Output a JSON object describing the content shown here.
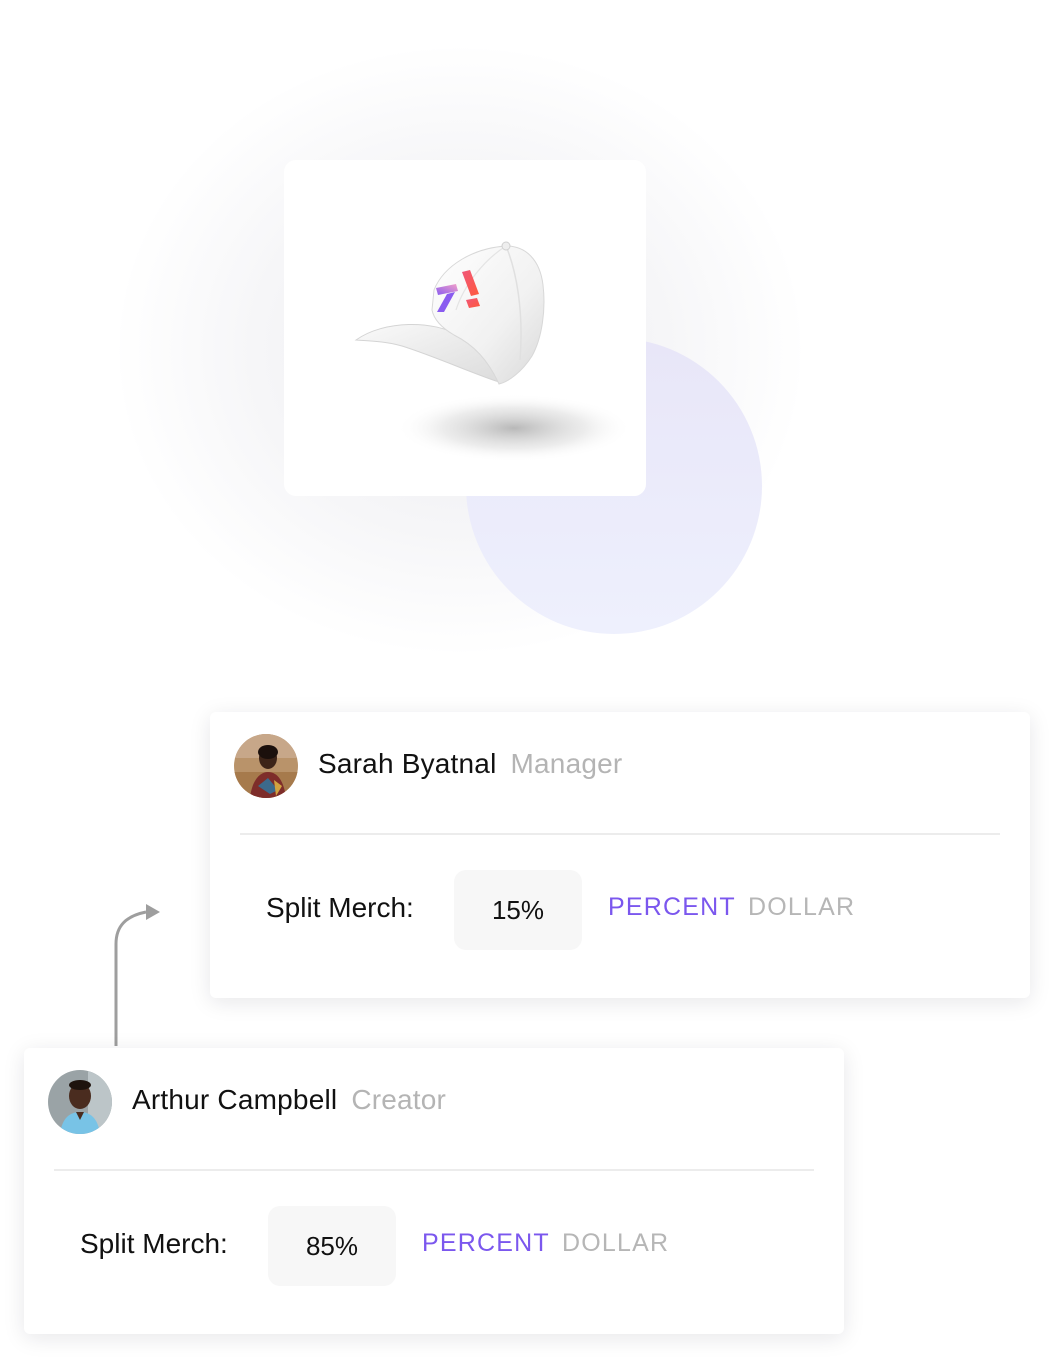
{
  "product": {
    "image_name": "white-cap-with-logo"
  },
  "colors": {
    "accent": "#7b57ee",
    "muted": "#b4b4b4",
    "circle": "#eceefc"
  },
  "splits": [
    {
      "name": "Sarah Byatnal",
      "role": "Manager",
      "label": "Split Merch:",
      "value": "15%",
      "mode_percent": "PERCENT",
      "mode_dollar": "DOLLAR",
      "active_mode": "PERCENT"
    },
    {
      "name": "Arthur Campbell",
      "role": "Creator",
      "label": "Split Merch:",
      "value": "85%",
      "mode_percent": "PERCENT",
      "mode_dollar": "DOLLAR",
      "active_mode": "PERCENT"
    }
  ]
}
